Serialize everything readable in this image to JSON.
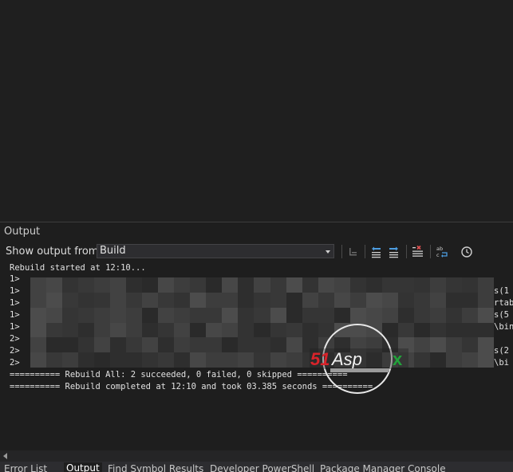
{
  "panel": {
    "title": "Output",
    "show_output_label": "Show output from:",
    "source_value": "Build"
  },
  "toolbar_icons": [
    "find-message-in-code-icon",
    "go-to-previous-message-icon",
    "go-to-next-message-icon",
    "clear-all-icon",
    "toggle-word-wrap-icon",
    "toggle-timestamp-icon"
  ],
  "output_lines": {
    "line1": "Rebuild started at 12:10...",
    "line2_prefix": "1>",
    "line3_prefix": "1>",
    "line4_prefix": "1>",
    "line5_prefix": "1>",
    "line6_prefix": "1>",
    "line7_prefix": "2>",
    "line8_prefix": "2>",
    "line9_prefix": "2>",
    "summary": "========== Rebuild All: 2 succeeded, 0 failed, 0 skipped ==========",
    "completed": "========== Rebuild completed at 12:10 and took 03.385 seconds =========="
  },
  "right_fragments": {
    "r1": "s(1",
    "r2": "rtab",
    "r3": "s(5",
    "r4": "\\bin",
    "r5": "s(2",
    "r6": "\\bi"
  },
  "watermark": {
    "brand": "51Aspx"
  },
  "tabs": [
    {
      "label": "Error List",
      "active": false
    },
    {
      "label": "Output",
      "active": true
    },
    {
      "label": "Find Symbol Results",
      "active": false
    },
    {
      "label": "Developer PowerShell",
      "active": false
    },
    {
      "label": "Package Manager Console",
      "active": false
    }
  ],
  "colors": {
    "background": "#1e1e1e",
    "accent_blue": "#4d9de0",
    "clear_red": "#e05252"
  }
}
